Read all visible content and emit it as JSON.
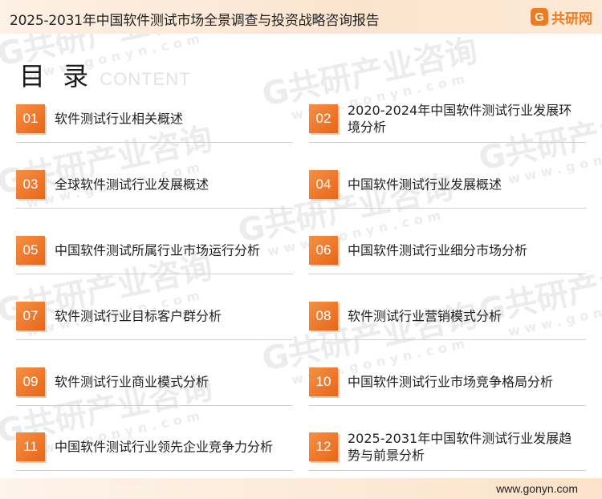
{
  "header": {
    "title": "2025-2031年中国软件测试市场全景调查与投资战略咨询报告",
    "brand_mark": "G",
    "brand_name": "共研网"
  },
  "toc": {
    "title": "目 录",
    "subtitle": "CONTENT",
    "items": [
      {
        "num": "01",
        "label": "软件测试行业相关概述"
      },
      {
        "num": "02",
        "label": "2020-2024年中国软件测试行业发展环境分析"
      },
      {
        "num": "03",
        "label": "全球软件测试行业发展概述"
      },
      {
        "num": "04",
        "label": "中国软件测试行业发展概述"
      },
      {
        "num": "05",
        "label": "中国软件测试所属行业市场运行分析"
      },
      {
        "num": "06",
        "label": "中国软件测试行业细分市场分析"
      },
      {
        "num": "07",
        "label": "软件测试行业目标客户群分析"
      },
      {
        "num": "08",
        "label": "软件测试行业营销模式分析"
      },
      {
        "num": "09",
        "label": "软件测试行业商业模式分析"
      },
      {
        "num": "10",
        "label": "中国软件测试行业市场竞争格局分析"
      },
      {
        "num": "11",
        "label": "中国软件测试行业领先企业竞争力分析"
      },
      {
        "num": "12",
        "label": "2025-2031年中国软件测试行业发展趋势与前景分析"
      }
    ]
  },
  "watermark": {
    "brand_text": "G共研产业咨询",
    "url_text": "www.gonyn.com"
  },
  "footer": {
    "url": "www.gonyn.com"
  },
  "colors": {
    "accent": "#e8651a",
    "header_bg": "#fbe4cf",
    "watermark": "#ebebeb"
  }
}
